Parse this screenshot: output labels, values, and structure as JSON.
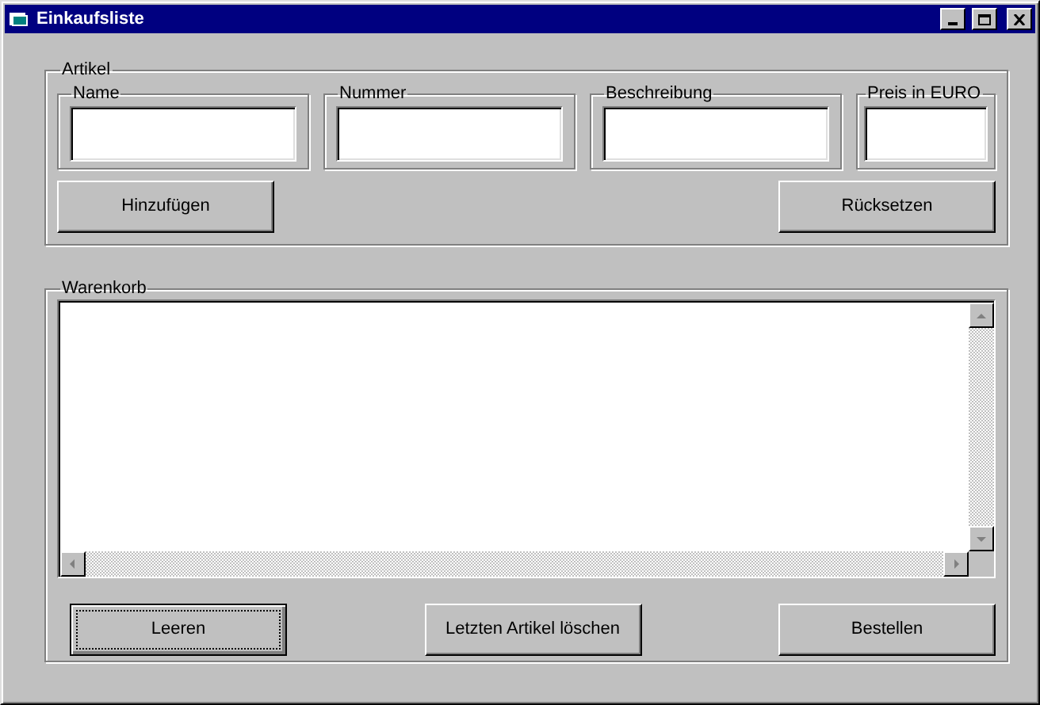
{
  "window": {
    "title": "Einkaufsliste"
  },
  "artikel": {
    "label": "Artikel",
    "fields": [
      {
        "label": "Name"
      },
      {
        "label": "Nummer"
      },
      {
        "label": "Beschreibung"
      },
      {
        "label": "Preis in EURO"
      }
    ],
    "buttons": [
      {
        "label": "Hinzufügen",
        "focused": false
      },
      {
        "label": "Rücksetzen",
        "focused": false
      }
    ]
  },
  "warenkorb": {
    "label": "Warenkorb",
    "buttons": [
      {
        "label": "Leeren",
        "focused": true
      },
      {
        "label": "Letzten Artikel löschen",
        "focused": false
      },
      {
        "label": "Bestellen",
        "focused": false
      }
    ]
  }
}
